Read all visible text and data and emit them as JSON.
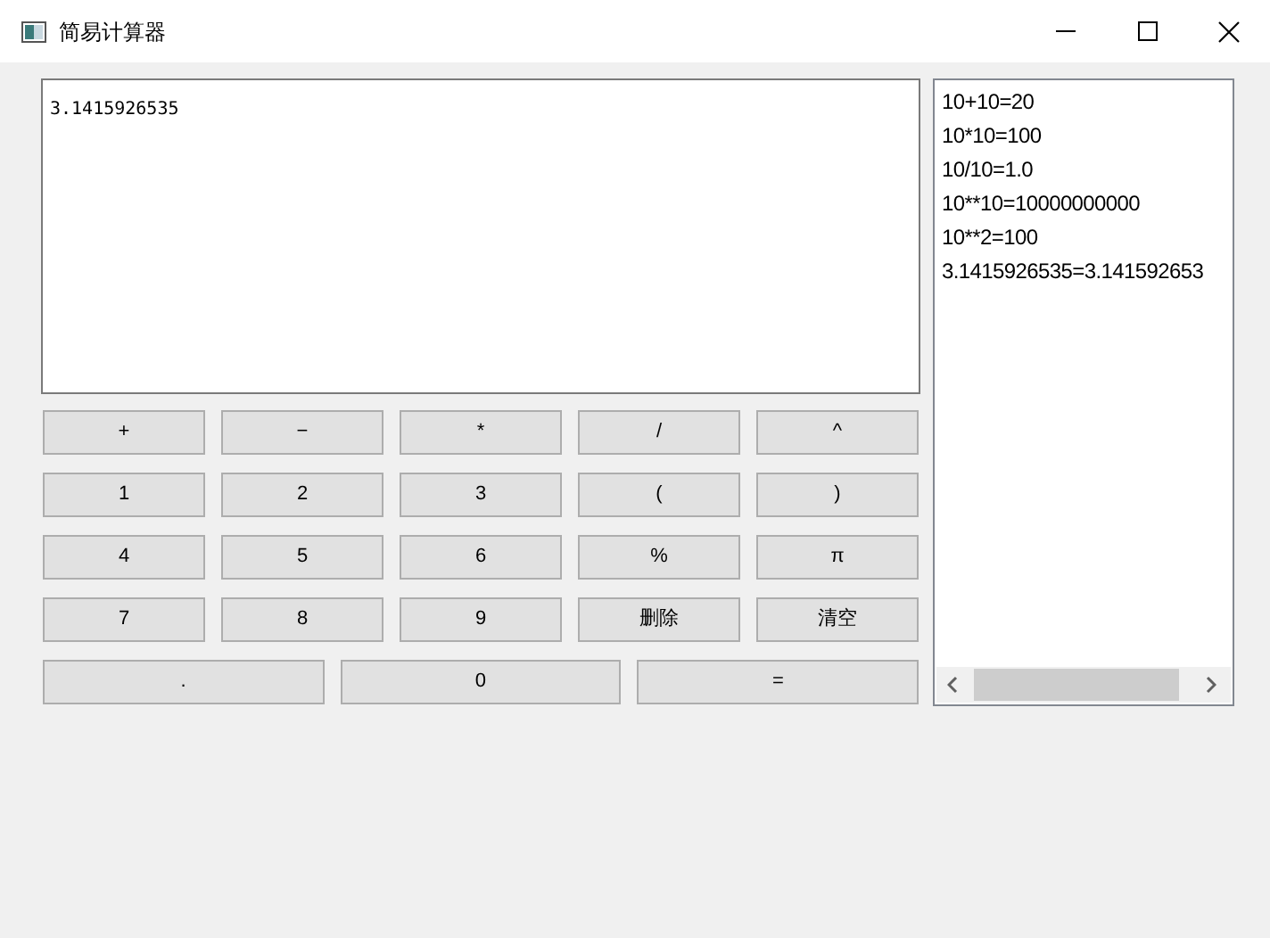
{
  "window": {
    "title": "简易计算器"
  },
  "display": {
    "value": "3.1415926535"
  },
  "keypad": [
    [
      "+",
      "−",
      "*",
      "/",
      "^"
    ],
    [
      "1",
      "2",
      "3",
      "(",
      ")"
    ],
    [
      "4",
      "5",
      "6",
      "%",
      "π"
    ],
    [
      "7",
      "8",
      "9",
      "删除",
      "清空"
    ],
    [
      ".",
      "0",
      "="
    ]
  ],
  "history": [
    "10+10=20",
    "10*10=100",
    "10/10=1.0",
    "10**10=10000000000",
    "10**2=100",
    "3.1415926535=3.141592653"
  ]
}
